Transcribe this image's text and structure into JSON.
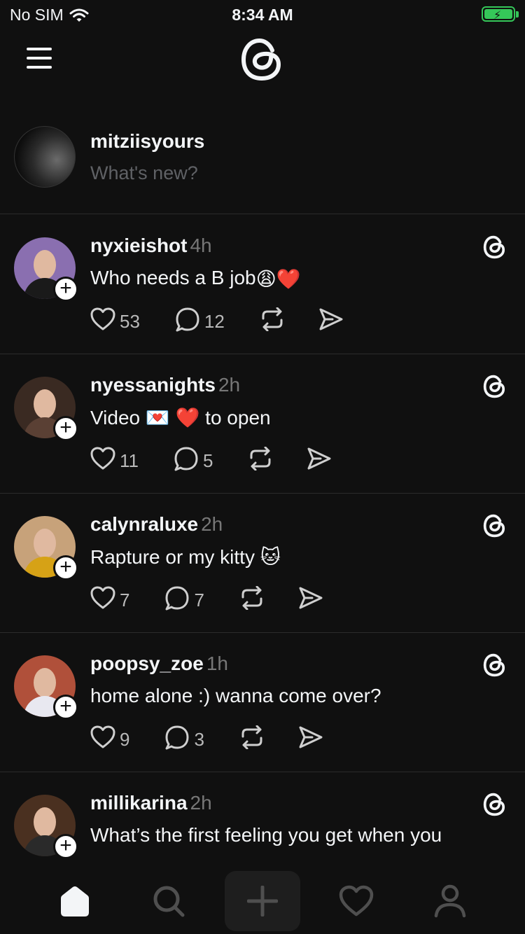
{
  "status_bar": {
    "carrier": "No SIM",
    "time": "8:34 AM"
  },
  "composer": {
    "username": "mitziisyours",
    "placeholder": "What's new?"
  },
  "posts": [
    {
      "username": "nyxieishot",
      "time": "4h",
      "text": "Who needs a B job",
      "emoji": "😩❤️",
      "likes": "53",
      "replies": "12",
      "avatar_hair": "#8a6fb0",
      "avatar_top": "#1a1a1a"
    },
    {
      "username": "nyessanights",
      "time": "2h",
      "text": "Video 💌 ❤️ to open",
      "emoji": "",
      "likes": "11",
      "replies": "5",
      "avatar_hair": "#3a2a22",
      "avatar_top": "#5a4034"
    },
    {
      "username": "calynraluxe",
      "time": "2h",
      "text": "Rapture or my  kitty 🐱",
      "emoji": "",
      "likes": "7",
      "replies": "7",
      "avatar_hair": "#c7a27a",
      "avatar_top": "#d6a216"
    },
    {
      "username": "poopsy_zoe",
      "time": "1h",
      "text": "home alone :) wanna come over?",
      "emoji": "",
      "likes": "9",
      "replies": "3",
      "avatar_hair": "#b0503a",
      "avatar_top": "#e8e8f0"
    },
    {
      "username": "millikarina",
      "time": "2h",
      "text": "What’s the first feeling you get when you",
      "emoji": "",
      "likes": "",
      "replies": "",
      "avatar_hair": "#4a3020",
      "avatar_top": "#2a2a2a"
    }
  ],
  "nav": [
    "home-icon",
    "search-icon",
    "create-icon",
    "activity-icon",
    "profile-icon"
  ],
  "colors": {
    "background": "#101010",
    "text": "#f3f5f7",
    "muted": "#777777",
    "battery": "#35c759"
  }
}
